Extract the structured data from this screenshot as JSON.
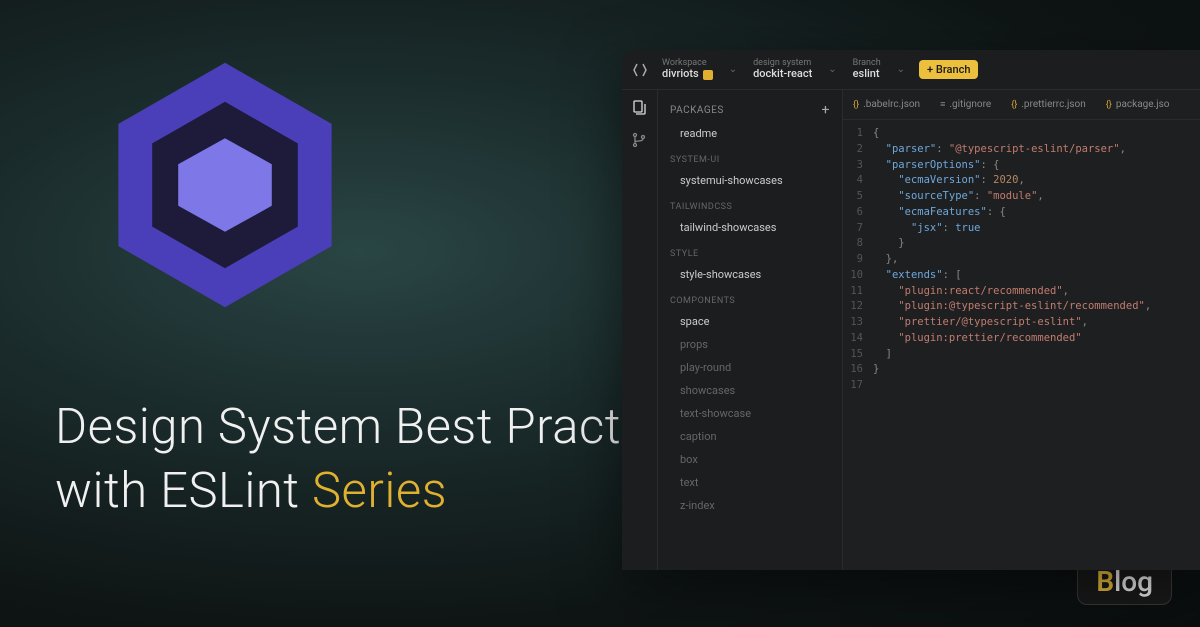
{
  "title": {
    "line1": "Design System Best Practices",
    "line2_prefix": "with ESLint ",
    "line2_accent": "Series"
  },
  "blog_badge": {
    "b": "B",
    "log": "log"
  },
  "ide": {
    "header": {
      "workspace_label": "Workspace",
      "workspace_value": "divriots",
      "ds_label": "design system",
      "ds_value": "dockit-react",
      "branch_label": "Branch",
      "branch_value": "eslint",
      "branch_btn": "+ Branch"
    },
    "sidebar": {
      "packages_label": "PACKAGES",
      "items": [
        {
          "type": "item",
          "label": "readme"
        },
        {
          "type": "group",
          "label": "SYSTEM-UI"
        },
        {
          "type": "item",
          "label": "systemui-showcases"
        },
        {
          "type": "group",
          "label": "TAILWINDCSS"
        },
        {
          "type": "item",
          "label": "tailwind-showcases"
        },
        {
          "type": "group",
          "label": "STYLE"
        },
        {
          "type": "item",
          "label": "style-showcases"
        },
        {
          "type": "group",
          "label": "COMPONENTS"
        },
        {
          "type": "item",
          "label": "space"
        },
        {
          "type": "item",
          "label": "props",
          "dim": true
        },
        {
          "type": "item",
          "label": "play-round",
          "dim": true
        },
        {
          "type": "item",
          "label": "showcases",
          "dim": true
        },
        {
          "type": "item",
          "label": "text-showcase",
          "dim": true
        },
        {
          "type": "item",
          "label": "caption",
          "dim": true
        },
        {
          "type": "item",
          "label": "box",
          "dim": true
        },
        {
          "type": "item",
          "label": "text",
          "dim": true
        },
        {
          "type": "item",
          "label": "z-index",
          "dim": true
        }
      ]
    },
    "tabs": [
      {
        "icon": "{}",
        "label": ".babelrc.json"
      },
      {
        "icon": "≡",
        "label": ".gitignore",
        "gray": true
      },
      {
        "icon": "{}",
        "label": ".prettierrc.json"
      },
      {
        "icon": "{}",
        "label": "package.jso"
      }
    ],
    "code": [
      {
        "n": 1,
        "tokens": [
          {
            "t": "{",
            "c": "punc"
          }
        ]
      },
      {
        "n": 2,
        "tokens": [
          {
            "t": "  ",
            "c": ""
          },
          {
            "t": "\"parser\"",
            "c": "key"
          },
          {
            "t": ": ",
            "c": "punc"
          },
          {
            "t": "\"@typescript-eslint/parser\"",
            "c": "str"
          },
          {
            "t": ",",
            "c": "punc"
          }
        ]
      },
      {
        "n": 3,
        "tokens": [
          {
            "t": "  ",
            "c": ""
          },
          {
            "t": "\"parserOptions\"",
            "c": "key"
          },
          {
            "t": ": {",
            "c": "punc"
          }
        ]
      },
      {
        "n": 4,
        "tokens": [
          {
            "t": "    ",
            "c": ""
          },
          {
            "t": "\"ecmaVersion\"",
            "c": "key"
          },
          {
            "t": ": ",
            "c": "punc"
          },
          {
            "t": "2020",
            "c": "num"
          },
          {
            "t": ",",
            "c": "punc"
          }
        ]
      },
      {
        "n": 5,
        "tokens": [
          {
            "t": "    ",
            "c": ""
          },
          {
            "t": "\"sourceType\"",
            "c": "key"
          },
          {
            "t": ": ",
            "c": "punc"
          },
          {
            "t": "\"module\"",
            "c": "str"
          },
          {
            "t": ",",
            "c": "punc"
          }
        ]
      },
      {
        "n": 6,
        "tokens": [
          {
            "t": "    ",
            "c": ""
          },
          {
            "t": "\"ecmaFeatures\"",
            "c": "key"
          },
          {
            "t": ": {",
            "c": "punc"
          }
        ]
      },
      {
        "n": 7,
        "tokens": [
          {
            "t": "      ",
            "c": ""
          },
          {
            "t": "\"jsx\"",
            "c": "key"
          },
          {
            "t": ": ",
            "c": "punc"
          },
          {
            "t": "true",
            "c": "bool"
          }
        ]
      },
      {
        "n": 8,
        "tokens": [
          {
            "t": "    }",
            "c": "punc"
          }
        ]
      },
      {
        "n": 9,
        "tokens": [
          {
            "t": "  },",
            "c": "punc"
          }
        ]
      },
      {
        "n": 10,
        "tokens": [
          {
            "t": "  ",
            "c": ""
          },
          {
            "t": "\"extends\"",
            "c": "key"
          },
          {
            "t": ": [",
            "c": "punc"
          }
        ]
      },
      {
        "n": 11,
        "tokens": [
          {
            "t": "    ",
            "c": ""
          },
          {
            "t": "\"plugin:react/recommended\"",
            "c": "str"
          },
          {
            "t": ",",
            "c": "punc"
          }
        ]
      },
      {
        "n": 12,
        "tokens": [
          {
            "t": "    ",
            "c": ""
          },
          {
            "t": "\"plugin:@typescript-eslint/recommended\"",
            "c": "str"
          },
          {
            "t": ",",
            "c": "punc"
          }
        ]
      },
      {
        "n": 13,
        "tokens": [
          {
            "t": "    ",
            "c": ""
          },
          {
            "t": "\"prettier/@typescript-eslint\"",
            "c": "str"
          },
          {
            "t": ",",
            "c": "punc"
          }
        ]
      },
      {
        "n": 14,
        "tokens": [
          {
            "t": "    ",
            "c": ""
          },
          {
            "t": "\"plugin:prettier/recommended\"",
            "c": "str"
          }
        ]
      },
      {
        "n": 15,
        "tokens": [
          {
            "t": "  ]",
            "c": "punc"
          }
        ]
      },
      {
        "n": 16,
        "tokens": [
          {
            "t": "}",
            "c": "punc"
          }
        ]
      },
      {
        "n": 17,
        "tokens": []
      }
    ]
  }
}
